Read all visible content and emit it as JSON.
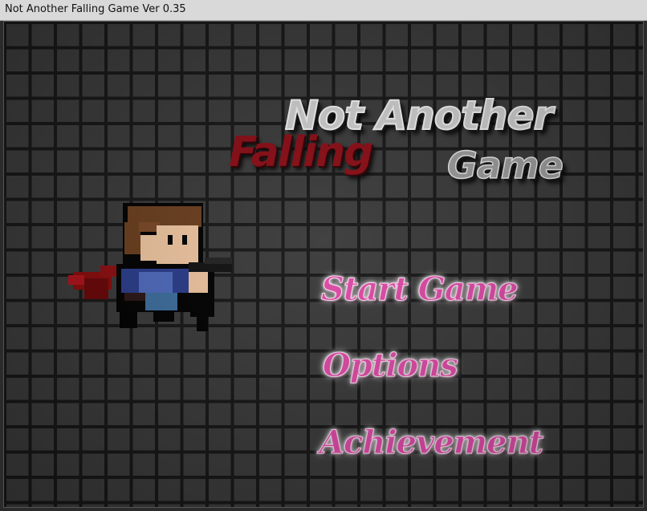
{
  "window": {
    "title": "Not Another Falling Game Ver 0.35"
  },
  "logo": {
    "line1": "Not Another",
    "line2_red": "Falling",
    "line2_gray": "Game"
  },
  "menu": {
    "items": [
      {
        "label": "Start Game"
      },
      {
        "label": "Options"
      },
      {
        "label": "Achievement"
      }
    ]
  },
  "colors": {
    "menu_text": "#e04aa8",
    "logo_red": "#8a0b14",
    "grid_line": "#161616",
    "grid_tile": "#3a3a3a"
  }
}
